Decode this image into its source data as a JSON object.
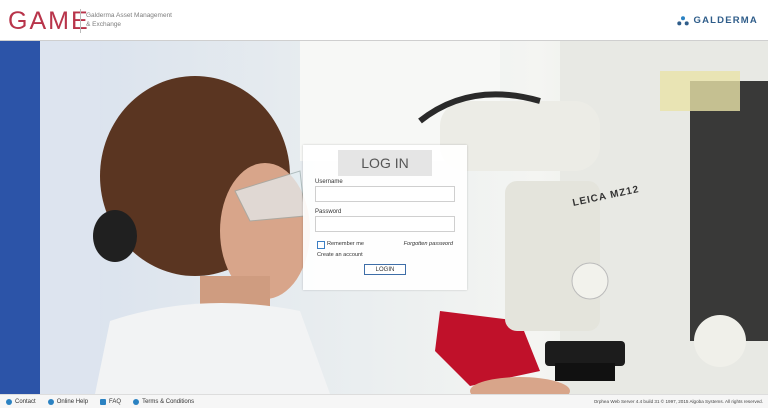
{
  "header": {
    "logo": "GAME",
    "subtitle_line1": "Galderma Asset Management",
    "subtitle_line2": "& Exchange",
    "brand": "GALDERMA"
  },
  "login": {
    "title": "LOG IN",
    "username_label": "Username",
    "username_value": "",
    "password_label": "Password",
    "password_value": "",
    "remember_label": "Remember me",
    "remember_checked": false,
    "forgot_link": "Forgotten password",
    "create_link": "Create an account",
    "submit_label": "LOGIN"
  },
  "hero": {
    "microscope_text": "LEICA MZ12"
  },
  "footer": {
    "items": [
      {
        "label": "Contact",
        "icon": "contact-icon"
      },
      {
        "label": "Online Help",
        "icon": "help-icon"
      },
      {
        "label": "FAQ",
        "icon": "faq-icon"
      },
      {
        "label": "Terms & Conditions",
        "icon": "terms-icon"
      }
    ],
    "copyright": "Orphea Web Server 4.4 build 31 © 1997, 2015 Algoba Systems. All rights reserved."
  },
  "colors": {
    "accent": "#b8344a",
    "brand": "#2f5d8a",
    "link": "#2b82c2"
  }
}
